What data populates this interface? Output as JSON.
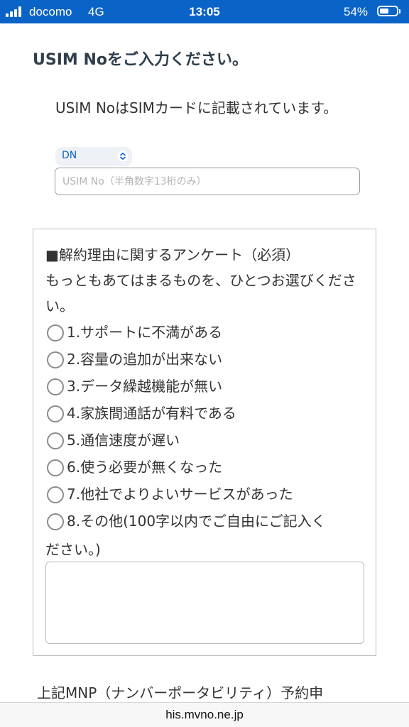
{
  "status_bar": {
    "carrier": "docomo",
    "network": "4G",
    "time": "13:05",
    "battery": "54%",
    "battery_level": 0.54
  },
  "page": {
    "title": "USIM Noをご入力ください。",
    "usim_note": "USIM NoはSIMカードに記載されています。",
    "dn_select_value": "DN",
    "usim_placeholder": "USIM No（半角数字13桁のみ）"
  },
  "survey": {
    "heading": "■解約理由に関するアンケート（必須）",
    "instruction": "もっともあてはまるものを、ひとつお選びください。",
    "options": [
      "1.サポートに不満がある",
      "2.容量の追加が出来ない",
      "3.データ繰越機能が無い",
      "4.家族間通話が有料である",
      "5.通信速度が遅い",
      "6.使う必要が無くなった",
      "7.他社でよりよいサービスがあった",
      "8.その他(100字以内でご自由にご記入く"
    ],
    "option_8_continued": "ださい。)"
  },
  "footer": {
    "partial_text": "上記MNP（ナンバーポータビリティ）予約申",
    "url": "his.mvno.ne.jp"
  }
}
